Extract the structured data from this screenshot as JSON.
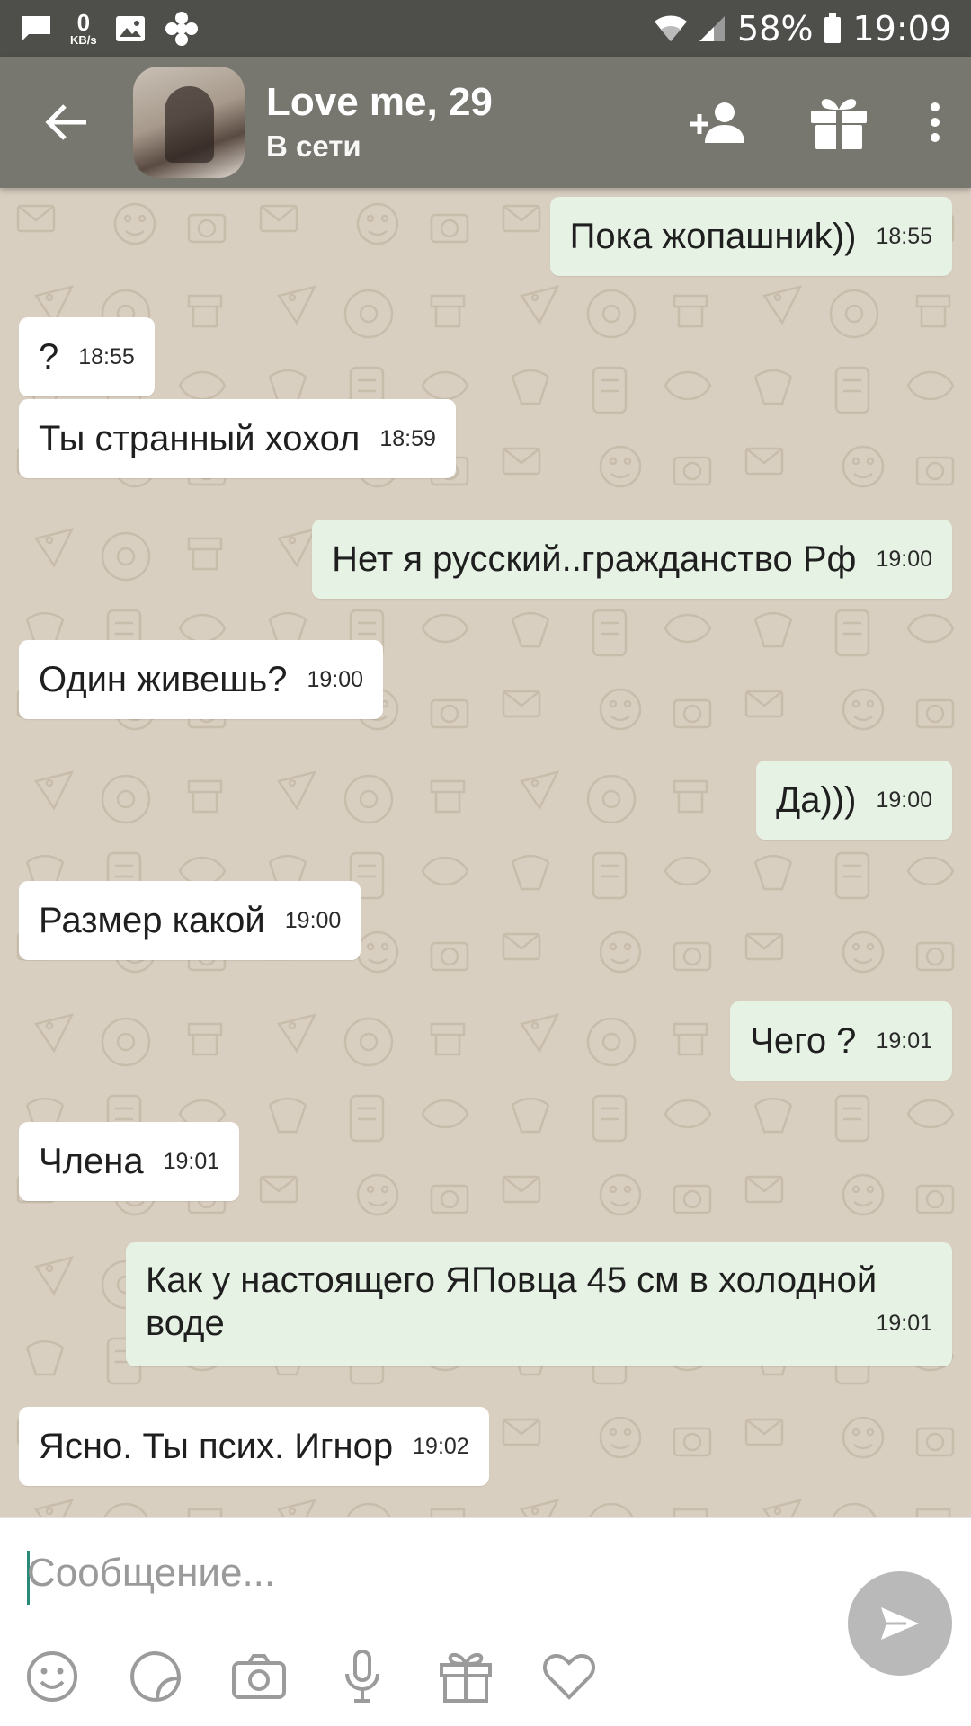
{
  "status_bar": {
    "net_speed_value": "0",
    "net_speed_unit": "KB/s",
    "battery": "58%",
    "time": "19:09",
    "icons": [
      "message-icon",
      "image-icon",
      "app-icon",
      "wifi-icon",
      "signal-icon",
      "battery-icon"
    ]
  },
  "header": {
    "name": "Love me, 29",
    "status": "В сети",
    "icons": [
      "back-arrow-icon",
      "add-friend-icon",
      "gift-icon",
      "more-icon"
    ]
  },
  "messages": [
    {
      "dir": "out",
      "text": "Пока жопашниk))",
      "time": "18:55"
    },
    {
      "dir": "in",
      "text": "?",
      "time": "18:55"
    },
    {
      "dir": "in",
      "text": "Ты странный хохол",
      "time": "18:59"
    },
    {
      "dir": "out",
      "text": "Нет я русский..гражданство Рф",
      "time": "19:00"
    },
    {
      "dir": "in",
      "text": "Один живешь?",
      "time": "19:00"
    },
    {
      "dir": "out",
      "text": "Да)))",
      "time": "19:00"
    },
    {
      "dir": "in",
      "text": "Размер какой",
      "time": "19:00"
    },
    {
      "dir": "out",
      "text": "Чего ?",
      "time": "19:01"
    },
    {
      "dir": "in",
      "text": "Члена",
      "time": "19:01"
    },
    {
      "dir": "out",
      "text_line1": "Как у настоящего ЯПовца 45 см в холодной",
      "text_line2": "воде",
      "time": "19:01"
    },
    {
      "dir": "in",
      "text": "Ясно. Ты псих. Игнор",
      "time": "19:02"
    }
  ],
  "composer": {
    "placeholder": "Сообщение...",
    "icons": [
      "emoji-icon",
      "sticker-icon",
      "camera-icon",
      "microphone-icon",
      "gift-icon",
      "heart-icon",
      "send-icon"
    ]
  },
  "colors": {
    "status_bar": "#4e4e4a",
    "toolbar": "#77776f",
    "chat_background": "#d9cfc1",
    "incoming_bubble": "#ffffff",
    "outgoing_bubble": "#e6f3e4",
    "send_button": "#b9b9b9"
  }
}
